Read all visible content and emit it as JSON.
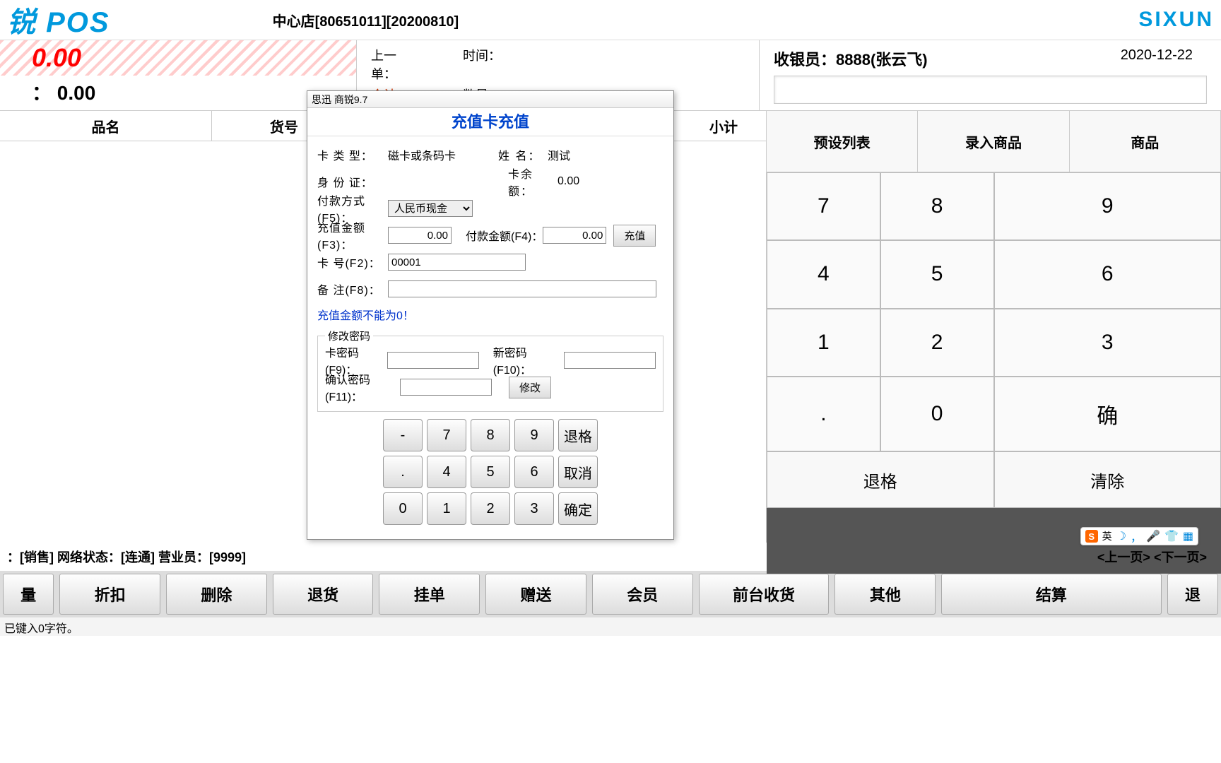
{
  "header": {
    "logo": "锐 POS",
    "store_info": "中心店[80651011][20200810]",
    "brand": "SIXUN"
  },
  "totals": {
    "red": "0.00",
    "black_label": "：",
    "black": "0.00"
  },
  "last_order": {
    "prev_label": "上一单：",
    "time_label": "时间：",
    "total_label": "合计：",
    "qty_label": "数量："
  },
  "cashier": {
    "label": "收银员：",
    "value": "8888(张云飞)",
    "date": "2020-12-22"
  },
  "grid_cols": [
    "品名",
    "货号",
    "小计"
  ],
  "right_tabs": [
    "预设列表",
    "录入商品",
    "商品"
  ],
  "keypad": [
    "7",
    "8",
    "9",
    "4",
    "5",
    "6",
    "1",
    "2",
    "3",
    ".",
    "0",
    "确"
  ],
  "bottom_keys": [
    "退格",
    "清除"
  ],
  "status": {
    "text": "：[销售] 网络状态：[连通] 营业员：[9999]",
    "prev": "<上一页>",
    "next": "<下一页>"
  },
  "bottom_buttons": [
    "量",
    "折扣",
    "删除",
    "退货",
    "挂单",
    "赠送",
    "会员",
    "前台收货",
    "其他",
    "结算",
    "退"
  ],
  "ime_status": "已键入0字符。",
  "dialog": {
    "app_title": "思迅 商锐9.7",
    "title": "充值卡充值",
    "card_type_label": "卡 类 型：",
    "card_type_value": "磁卡或条码卡",
    "name_label": "姓  名：",
    "name_value": "测试",
    "id_label": "身 份 证：",
    "balance_label": "卡余额：",
    "balance_value": "0.00",
    "pay_method_label": "付款方式(F5)：",
    "pay_method_value": "人民币现金",
    "recharge_amt_label": "充值金额(F3)：",
    "recharge_amt_value": "0.00",
    "pay_amt_label": "付款金额(F4)：",
    "pay_amt_value": "0.00",
    "recharge_btn": "充值",
    "card_no_label": "卡    号(F2)：",
    "card_no_value": "00001",
    "note_label": "备    注(F8)：",
    "note_value": "",
    "error_msg": "充值金额不能为0！",
    "pw_legend": "修改密码",
    "card_pw_label": "卡密码(F9)：",
    "new_pw_label": "新密码(F10)：",
    "confirm_pw_label": "确认密码(F11)：",
    "modify_btn": "修改",
    "keypad": [
      "-",
      "7",
      "8",
      "9",
      "退格",
      ".",
      "4",
      "5",
      "6",
      "取消",
      "0",
      "1",
      "2",
      "3",
      "确定"
    ]
  },
  "ime_bar": {
    "lang": "英"
  }
}
